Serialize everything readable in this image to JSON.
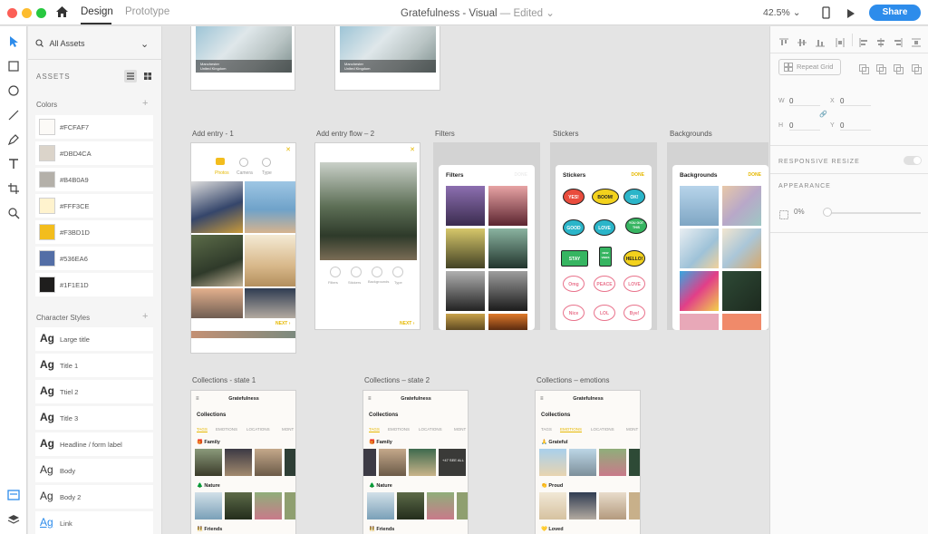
{
  "titlebar": {
    "tabs": [
      "Design",
      "Prototype"
    ],
    "doc_title": "Gratefulness - Visual",
    "status": "Edited",
    "zoom": "42.5%",
    "share_label": "Share"
  },
  "assets": {
    "filter_label": "All Assets",
    "header": "ASSETS",
    "colors_title": "Colors",
    "colors": [
      {
        "label": "#FCFAF7",
        "hex": "#FCFAF7"
      },
      {
        "label": "#DBD4CA",
        "hex": "#DBD4CA"
      },
      {
        "label": "#B4B0A9",
        "hex": "#B4B0A9"
      },
      {
        "label": "#FFF3CE",
        "hex": "#FFF3CE"
      },
      {
        "label": "#F3BD1D",
        "hex": "#F3BD1D"
      },
      {
        "label": "#536EA6",
        "hex": "#536EA6"
      },
      {
        "label": "#1F1E1D",
        "hex": "#1F1E1D"
      }
    ],
    "char_styles_title": "Character Styles",
    "char_glyph": "Ag",
    "char_styles": [
      "Large title",
      "Title 1",
      "Ttiel 2",
      "Title 3",
      "Headline / form label",
      "Body",
      "Body 2",
      "Link"
    ]
  },
  "canvas": {
    "artboards": {
      "add_entry_1": "Add entry - 1",
      "add_entry_flow_2": "Add entry flow – 2",
      "filters": "Filters",
      "stickers": "Stickers",
      "backgrounds": "Backgrounds",
      "collections_1": "Collections - state 1",
      "collections_2": "Collections – state 2",
      "collections_emotions": "Collections – emotions"
    },
    "top_card_caption": "Manchester\nUnited Kingdom",
    "entry_tabs": [
      "Photos",
      "Camera",
      "Type"
    ],
    "flow_tools": [
      "Filters",
      "Stickers",
      "Backgrounds",
      "Type"
    ],
    "next_label": "NEXT ›",
    "filters_card": {
      "title": "Filters",
      "done": "DONE"
    },
    "stickers_card": {
      "title": "Stickers",
      "done": "DONE",
      "items": [
        "YES!",
        "BOOM!",
        "OK!",
        "GOOD",
        "LOVE",
        "YOU GOT THIS",
        "STAY COOL",
        "NEW VIBES",
        "HELLO!",
        "Omg",
        "PEACE",
        "LOVE",
        "Nice",
        "LOL",
        "Bye!"
      ]
    },
    "backgrounds_card": {
      "title": "Backgrounds",
      "done": "DONE"
    },
    "collections": {
      "app_title": "Gratefulness",
      "heading": "Collections",
      "tabs": [
        "TAGS",
        "EMOTIONS",
        "LOCATIONS",
        "MONT"
      ],
      "sections_tags": [
        "Family",
        "Nature",
        "Friends"
      ],
      "sections_emotions": [
        "Grateful",
        "Proud",
        "Loved"
      ],
      "see_all": "+47 SEE ALL"
    }
  },
  "inspector": {
    "repeat_grid": "Repeat Grid",
    "w_label": "W",
    "w_value": "0",
    "x_label": "X",
    "x_value": "0",
    "h_label": "H",
    "h_value": "0",
    "y_label": "Y",
    "y_value": "0",
    "responsive": "RESPONSIVE RESIZE",
    "appearance": "APPEARANCE",
    "opacity": "0%"
  }
}
